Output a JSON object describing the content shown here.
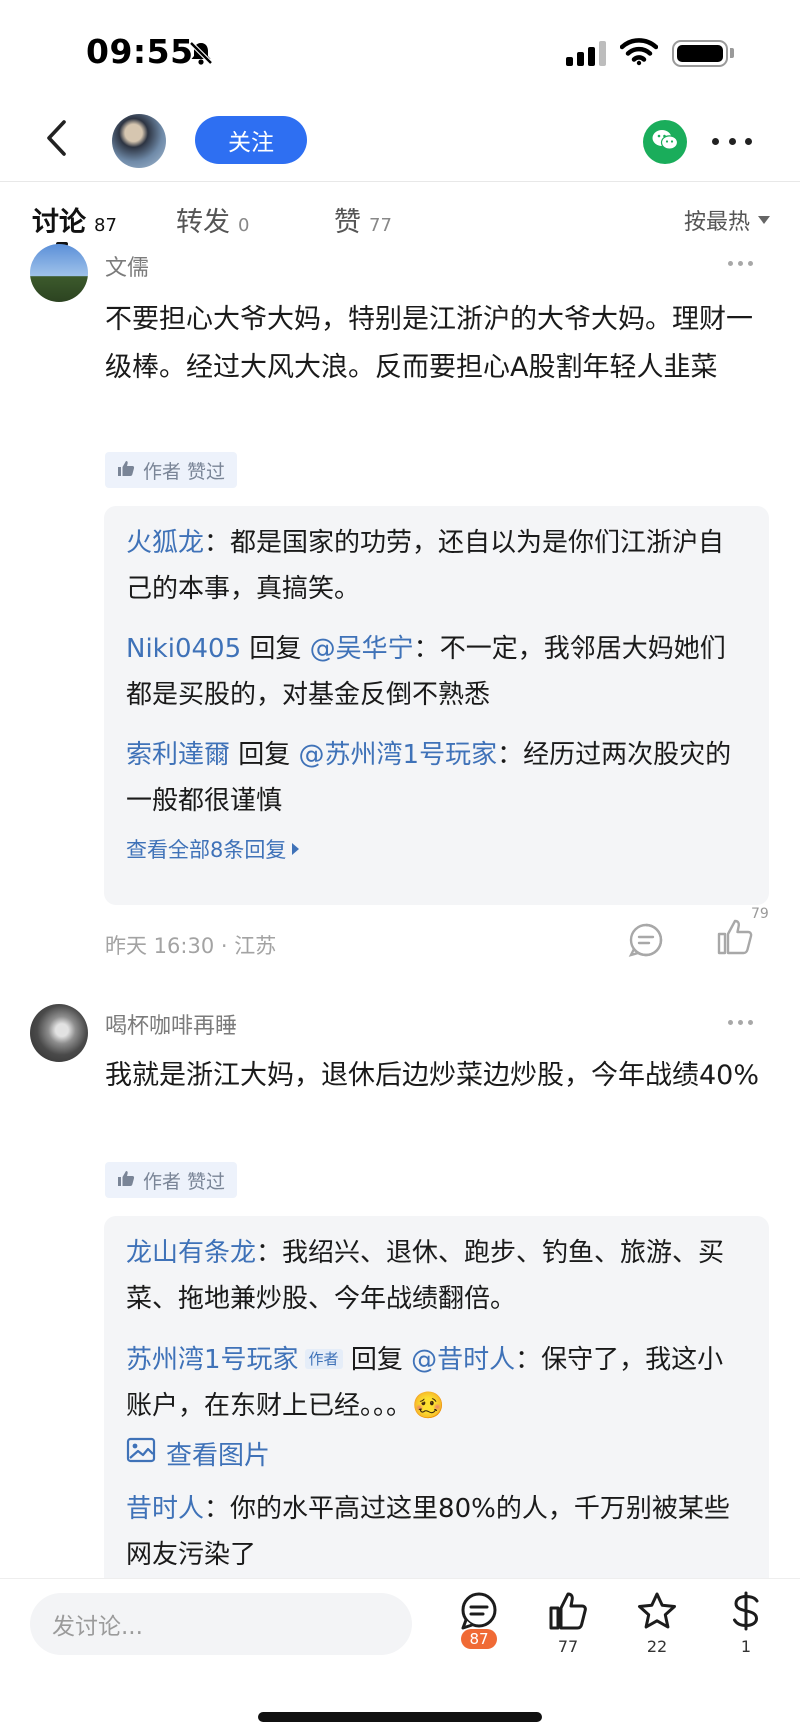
{
  "status_bar": {
    "time": "09:55"
  },
  "nav": {
    "follow_label": "关注"
  },
  "tabs": [
    {
      "label": "讨论",
      "count": "87",
      "active": true
    },
    {
      "label": "转发",
      "count": "0",
      "active": false
    },
    {
      "label": "赞",
      "count": "77",
      "active": false
    }
  ],
  "sort": {
    "label": "按最热"
  },
  "comments": [
    {
      "username": "文儒",
      "text": "不要担心大爷大妈，特别是江浙沪的大爷大妈。理财一级棒。经过大风大浪。反而要担心A股割年轻人韭菜",
      "author_liked": "作者 赞过",
      "replies": [
        {
          "user": "火狐龙",
          "sep": "：",
          "text": "都是国家的功劳，还自以为是你们江浙沪自己的本事，真搞笑。"
        },
        {
          "user": "Niki0405",
          "reply_word": " 回复 ",
          "mention": "@吴华宁",
          "sep": "：",
          "text": "不一定，我邻居大妈她们都是买股的，对基金反倒不熟悉"
        },
        {
          "user": "索利達爾",
          "reply_word": " 回复 ",
          "mention": "@苏州湾1号玩家",
          "sep": "：",
          "text": "经历过两次股灾的一般都很谨慎"
        }
      ],
      "view_all": "查看全部8条回复",
      "meta": "昨天 16:30 · 江苏",
      "like_count": "79"
    },
    {
      "username": "喝杯咖啡再睡",
      "text": "我就是浙江大妈，退休后边炒菜边炒股，今年战绩40%",
      "author_liked": "作者 赞过",
      "replies": [
        {
          "user": "龙山有条龙",
          "sep": "：",
          "text": "我绍兴、退休、跑步、钓鱼、旅游、买菜、拖地兼炒股、今年战绩翻倍。"
        },
        {
          "user": "苏州湾1号玩家",
          "author_tag": "作者",
          "reply_word": " 回复 ",
          "mention": "@昔时人",
          "sep": "：",
          "text": "保守了，我这小账户，在东财上已经。。。",
          "emoji": "🥴",
          "view_image": "查看图片"
        },
        {
          "user": "昔时人",
          "sep": "：",
          "text": "你的水平高过这里80%的人，千万别被某些网友污染了"
        }
      ]
    }
  ],
  "bottom_bar": {
    "input_placeholder": "发讨论...",
    "comments_count": "87",
    "likes_count": "77",
    "favorites_count": "22",
    "tips_count": "1"
  },
  "icons": [
    "back-icon",
    "bell-off-icon",
    "signal-icon",
    "wifi-icon",
    "battery-icon",
    "wechat-icon",
    "more-icon",
    "thumb-up-icon",
    "comment-icon",
    "star-icon",
    "dollar-icon",
    "image-icon"
  ],
  "colors": {
    "accent_blue": "#2e6ff2",
    "link_blue": "#3f72b8",
    "wechat_green": "#1aad5b",
    "badge_orange": "#f06a35"
  }
}
